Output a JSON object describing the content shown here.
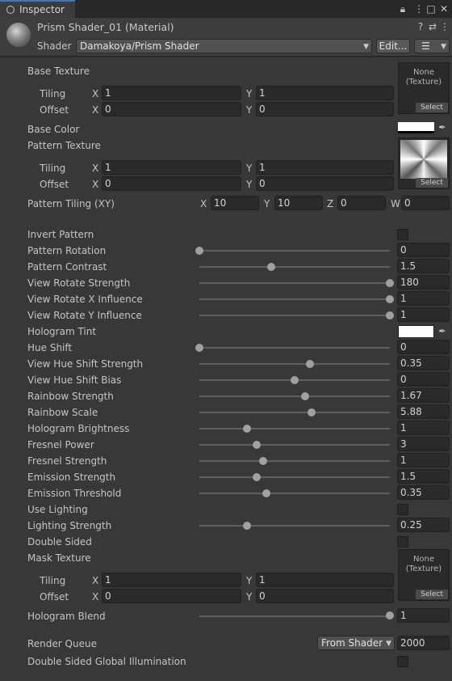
{
  "tab": {
    "title": "Inspector"
  },
  "material": {
    "title": "Prism Shader_01 (Material)",
    "shader_label": "Shader",
    "shader_value": "Damakoya/Prism Shader",
    "edit_label": "Edit..."
  },
  "texture_common": {
    "tiling_label": "Tiling",
    "offset_label": "Offset",
    "none_label": "None",
    "none_sub": "(Texture)",
    "select_label": "Select"
  },
  "base_texture": {
    "label": "Base Texture",
    "tiling_x": "1",
    "tiling_y": "1",
    "offset_x": "0",
    "offset_y": "0"
  },
  "base_color": {
    "label": "Base Color",
    "color": "#ffffff"
  },
  "pattern_texture": {
    "label": "Pattern Texture",
    "tiling_x": "1",
    "tiling_y": "1",
    "offset_x": "0",
    "offset_y": "0"
  },
  "pattern_tiling": {
    "label": "Pattern Tiling (XY)",
    "x": "10",
    "y": "10",
    "z": "0",
    "w": "0"
  },
  "axes": {
    "x": "X",
    "y": "Y",
    "z": "Z",
    "w": "W"
  },
  "props": [
    {
      "label": "Invert Pattern",
      "type": "checkbox"
    },
    {
      "label": "Pattern Rotation",
      "type": "slider",
      "value": "0",
      "fraction": 0.0
    },
    {
      "label": "Pattern Contrast",
      "type": "slider",
      "value": "1.5",
      "fraction": 0.375
    },
    {
      "label": "View Rotate Strength",
      "type": "slider",
      "value": "180",
      "fraction": 1.0
    },
    {
      "label": "View Rotate X Influence",
      "type": "slider",
      "value": "1",
      "fraction": 1.0
    },
    {
      "label": "View Rotate Y Influence",
      "type": "slider",
      "value": "1",
      "fraction": 1.0
    },
    {
      "label": "Hologram Tint",
      "type": "color",
      "color": "#ffffff"
    },
    {
      "label": "Hue Shift",
      "type": "slider",
      "value": "0",
      "fraction": 0.0
    },
    {
      "label": "View Hue Shift Strength",
      "type": "slider",
      "value": "0.35",
      "fraction": 0.58
    },
    {
      "label": "View Hue Shift Bias",
      "type": "slider",
      "value": "0",
      "fraction": 0.5
    },
    {
      "label": "Rainbow Strength",
      "type": "slider",
      "value": "1.67",
      "fraction": 0.555
    },
    {
      "label": "Rainbow Scale",
      "type": "slider",
      "value": "5.88",
      "fraction": 0.588
    },
    {
      "label": "Hologram Brightness",
      "type": "slider",
      "value": "1",
      "fraction": 0.25
    },
    {
      "label": "Fresnel Power",
      "type": "slider",
      "value": "3",
      "fraction": 0.3
    },
    {
      "label": "Fresnel Strength",
      "type": "slider",
      "value": "1",
      "fraction": 0.333
    },
    {
      "label": "Emission Strength",
      "type": "slider",
      "value": "1.5",
      "fraction": 0.3
    },
    {
      "label": "Emission Threshold",
      "type": "slider",
      "value": "0.35",
      "fraction": 0.35
    },
    {
      "label": "Use Lighting",
      "type": "checkbox"
    },
    {
      "label": "Lighting Strength",
      "type": "slider",
      "value": "0.25",
      "fraction": 0.25
    },
    {
      "label": "Double Sided",
      "type": "checkbox"
    }
  ],
  "mask_texture": {
    "label": "Mask Texture",
    "tiling_x": "1",
    "tiling_y": "1",
    "offset_x": "0",
    "offset_y": "0"
  },
  "hologram_blend": {
    "label": "Hologram Blend",
    "value": "1",
    "fraction": 1.0
  },
  "render_queue": {
    "label": "Render Queue",
    "mode": "From Shader",
    "value": "2000"
  },
  "double_sided_gi": {
    "label": "Double Sided Global Illumination"
  }
}
